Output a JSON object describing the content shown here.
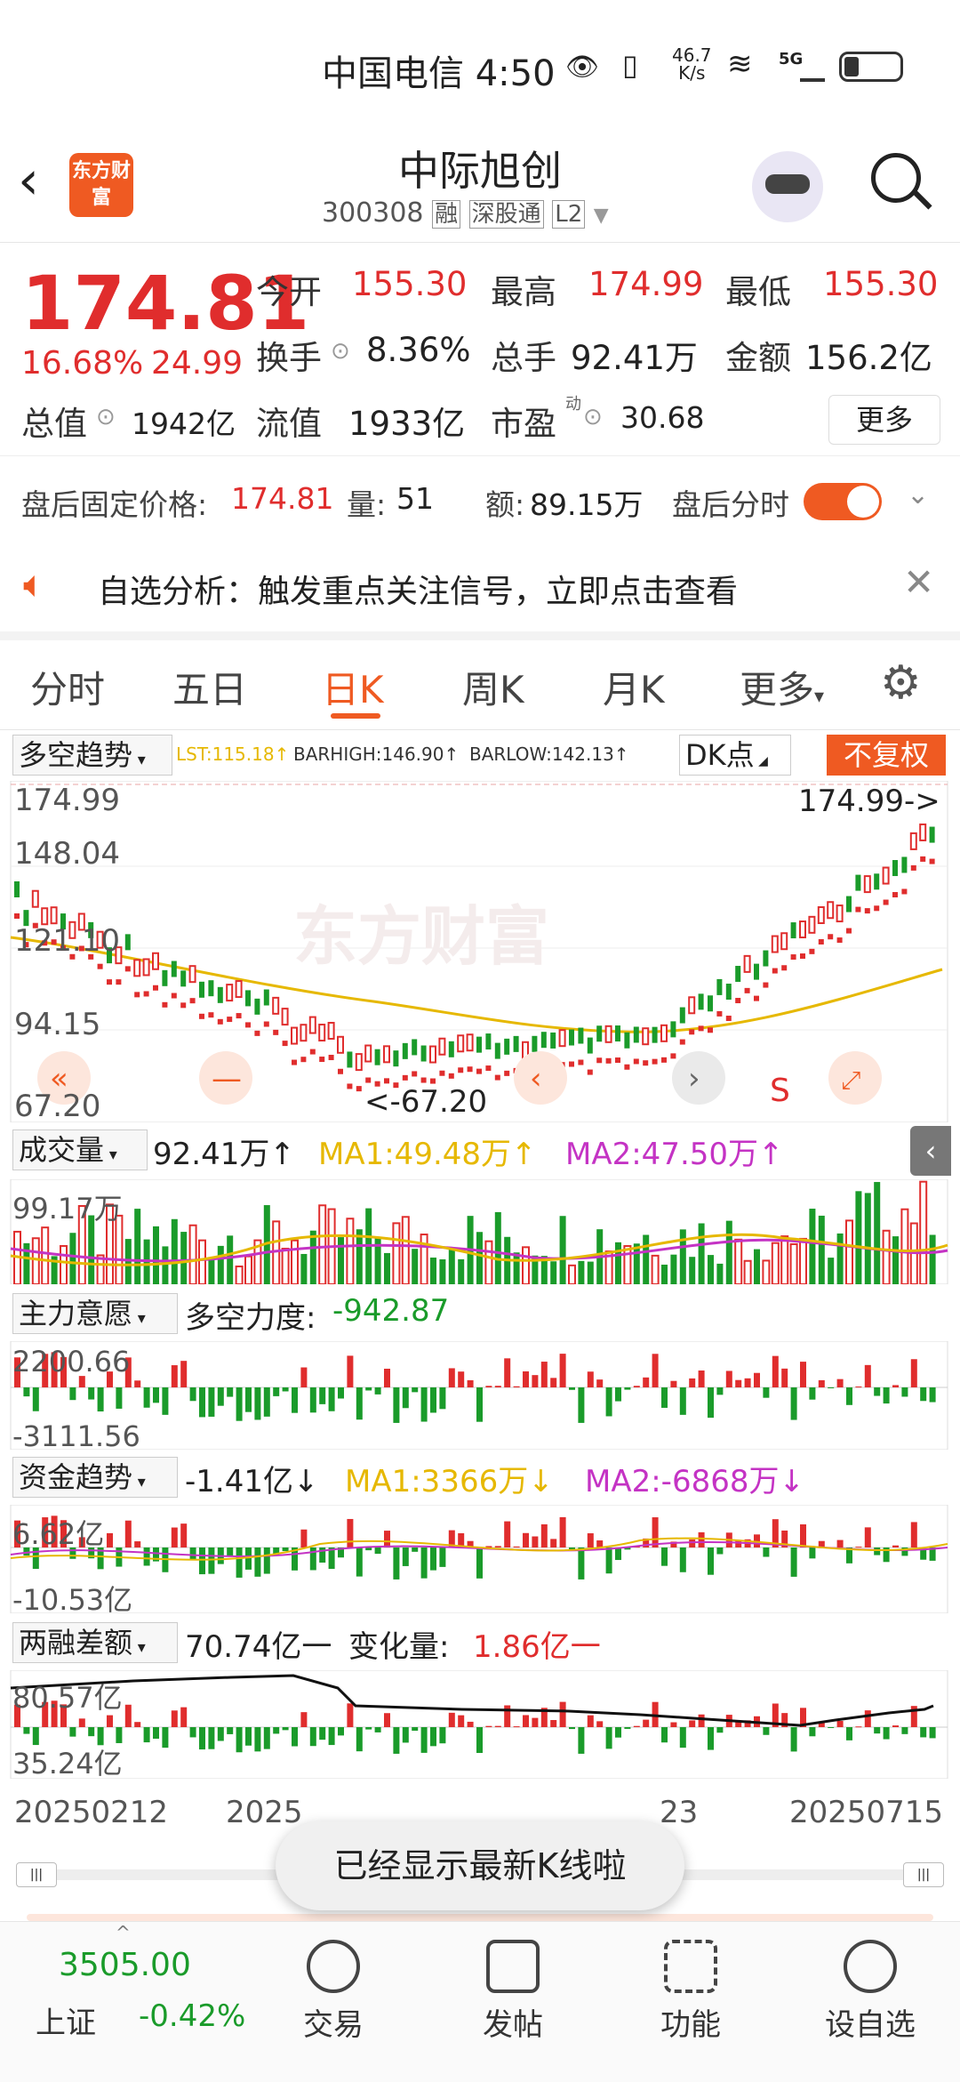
{
  "status_bar": {
    "carrier_time": "中国电信 4:50",
    "speed": "46.7",
    "speed_unit": "K/s",
    "network": "5G"
  },
  "header": {
    "title": "中际旭创",
    "code": "300308",
    "tags": [
      "融",
      "深股通",
      "L2"
    ],
    "logo_text": "东方财富"
  },
  "quote": {
    "price": "174.81",
    "pct": "16.68%",
    "change": "24.99",
    "row1": [
      {
        "label": "今开",
        "value": "155.30"
      },
      {
        "label": "最高",
        "value": "174.99"
      },
      {
        "label": "最低",
        "value": "155.30"
      }
    ],
    "row2": [
      {
        "label": "换手",
        "value": "8.36%"
      },
      {
        "label": "总手",
        "value": "92.41万"
      },
      {
        "label": "金额",
        "value": "156.2亿"
      }
    ],
    "row3": [
      {
        "label": "总值",
        "value": "1942亿"
      },
      {
        "label": "流值",
        "value": "1933亿"
      },
      {
        "label": "市盈",
        "sup": "动",
        "value": "30.68"
      }
    ],
    "more": "更多"
  },
  "after_hours": {
    "label": "盘后固定价格:",
    "price": "174.81",
    "vol_label": "量:",
    "vol": "51",
    "amt_label": "额:",
    "amt": "89.15万",
    "toggle_label": "盘后分时",
    "toggle_on": true
  },
  "notice": {
    "text": "自选分析：触发重点关注信号，立即点击查看"
  },
  "tabs": [
    {
      "label": "分时"
    },
    {
      "label": "五日"
    },
    {
      "label": "日K",
      "active": true
    },
    {
      "label": "周K"
    },
    {
      "label": "月K"
    },
    {
      "label": "更多"
    }
  ],
  "kline": {
    "indicator": "多空趋势",
    "lst": "LST:115.18↑",
    "barhigh": "BARHIGH:146.90↑",
    "barlow": "BARLOW:142.13↑",
    "dk_label": "DK点",
    "adjust_label": "不复权",
    "axis": [
      "174.99",
      "148.04",
      "121.10",
      "94.15",
      "67.20"
    ],
    "max_label": "174.99->",
    "min_label": "<-67.20",
    "signal": "S",
    "watermark": "东方财富"
  },
  "volume": {
    "label": "成交量",
    "value": "92.41万↑",
    "ma1": "MA1:49.48万↑",
    "ma2": "MA2:47.50万↑",
    "axis_top": "99.17万"
  },
  "main_force": {
    "label": "主力意愿",
    "value_label": "多空力度:",
    "value": "-942.87",
    "axis_top": "2200.66",
    "axis_bottom": "-3111.56"
  },
  "fund_trend": {
    "label": "资金趋势",
    "value": "-1.41亿↓",
    "ma1": "MA1:3366万↓",
    "ma2": "MA2:-6868万↓",
    "axis_top": "6.62亿",
    "axis_bottom": "-10.53亿"
  },
  "margin": {
    "label": "两融差额",
    "value": "70.74亿一",
    "change_label": "变化量:",
    "change": "1.86亿一",
    "axis_top": "80.57亿",
    "axis_bottom": "35.24亿"
  },
  "dates": {
    "start": "20250212",
    "mid1": "2025",
    "mid2": "23",
    "end": "20250715"
  },
  "toast": "已经显示最新K线啦",
  "bottom_nav": {
    "index_value": "3505.00",
    "index_name": "上证",
    "index_pct": "-0.42%",
    "items": [
      "交易",
      "发帖",
      "功能",
      "设自选"
    ]
  },
  "colors": {
    "up": "#e02d2d",
    "down": "#1a9b2a",
    "accent": "#ef5a22",
    "ma_yellow": "#e6b800",
    "ma_purple": "#c433c4"
  }
}
